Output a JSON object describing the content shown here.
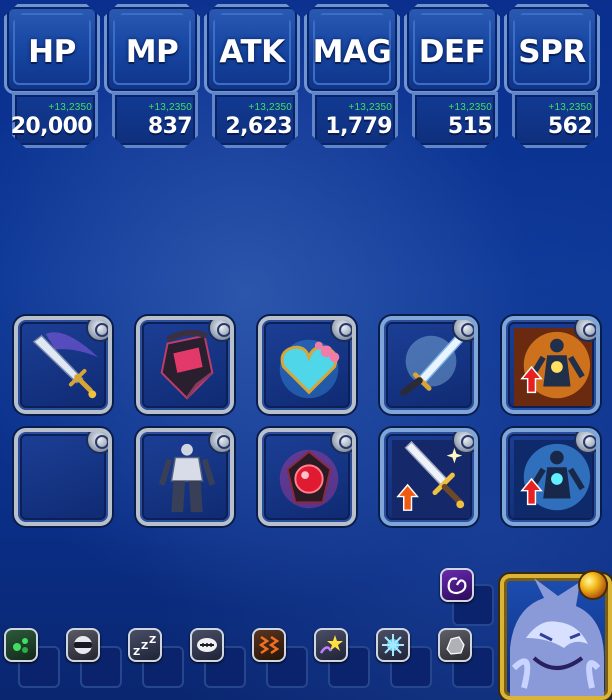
{
  "stats": [
    {
      "name": "HP",
      "bonus": "+13,2350",
      "value": "20,000"
    },
    {
      "name": "MP",
      "bonus": "+13,2350",
      "value": "837"
    },
    {
      "name": "ATK",
      "bonus": "+13,2350",
      "value": "2,623"
    },
    {
      "name": "MAG",
      "bonus": "+13,2350",
      "value": "1,779"
    },
    {
      "name": "DEF",
      "bonus": "+13,2350",
      "value": "515"
    },
    {
      "name": "SPR",
      "bonus": "+13,2350",
      "value": "562"
    }
  ],
  "equipment": {
    "row1": [
      "sword-icon",
      "helmet-icon",
      "heart-accessory-icon",
      "light-sword-icon",
      "ability-up-orange-icon"
    ],
    "row2": [
      "empty-slot",
      "armor-icon",
      "red-gem-accessory-icon",
      "attack-up-sword-icon",
      "ability-up-blue-icon"
    ]
  },
  "status_icons": [
    "poison-icon",
    "blind-icon",
    "sleep-icon",
    "silence-icon",
    "paralyze-icon",
    "confuse-icon",
    "disease-icon",
    "petrify-icon"
  ],
  "extra_status_icon": "vortex-icon",
  "portrait": "wolf-unit-icon",
  "colors": {
    "bonus_green": "#3fe060",
    "panel_blue": "#1746a2",
    "frame_silver": "#b8c0cc",
    "portrait_gold": "#d9b437"
  }
}
